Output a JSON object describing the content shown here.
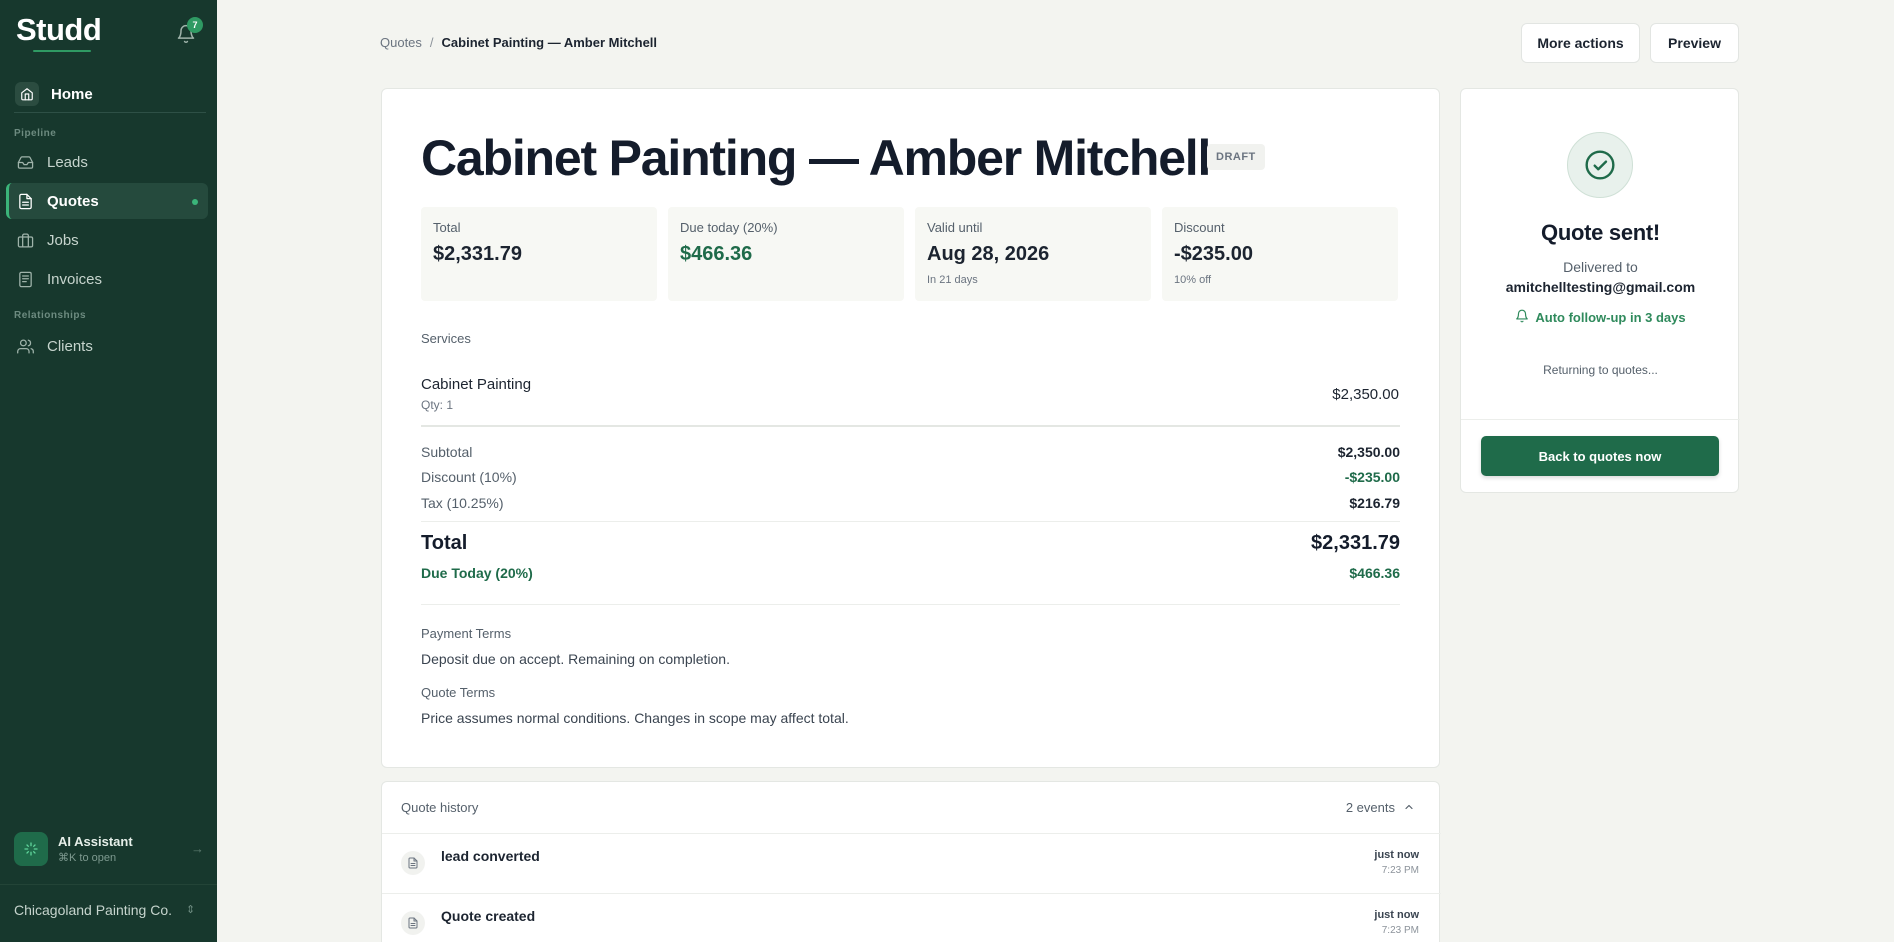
{
  "sidebar": {
    "logo": "Studd",
    "notifications_count": "7",
    "home_label": "Home",
    "sections": {
      "pipeline": "Pipeline",
      "relationships": "Relationships"
    },
    "items": [
      {
        "label": "Leads",
        "icon": "inbox-icon"
      },
      {
        "label": "Quotes",
        "icon": "document-icon"
      },
      {
        "label": "Jobs",
        "icon": "briefcase-icon"
      },
      {
        "label": "Invoices",
        "icon": "invoice-icon"
      },
      {
        "label": "Clients",
        "icon": "users-icon"
      }
    ],
    "ai_assistant": {
      "title": "AI Assistant",
      "shortcut": "⌘K to open"
    },
    "company": "Chicagoland Painting Co."
  },
  "breadcrumb": {
    "parent": "Quotes",
    "separator": "/",
    "current": "Cabinet Painting — Amber Mitchell"
  },
  "header_actions": {
    "more_actions": "More actions",
    "preview": "Preview"
  },
  "quote": {
    "title": "Cabinet Painting — Amber Mitchell",
    "status": "DRAFT",
    "stats": [
      {
        "label": "Total",
        "value": "$2,331.79",
        "sub": ""
      },
      {
        "label": "Due today (20%)",
        "value": "$466.36",
        "sub": ""
      },
      {
        "label": "Valid until",
        "value": "Aug 28, 2026",
        "sub": "In 21 days"
      },
      {
        "label": "Discount",
        "value": "-$235.00",
        "sub": "10% off"
      }
    ],
    "services_label": "Services",
    "services": [
      {
        "name": "Cabinet Painting",
        "qty": "Qty: 1",
        "amount": "$2,350.00"
      }
    ],
    "summary": {
      "subtotal_label": "Subtotal",
      "subtotal": "$2,350.00",
      "discount_label": "Discount (10%)",
      "discount": "-$235.00",
      "tax_label": "Tax (10.25%)",
      "tax": "$216.79",
      "total_label": "Total",
      "total": "$2,331.79",
      "due_label": "Due Today (20%)",
      "due": "$466.36"
    },
    "payment_terms_label": "Payment Terms",
    "payment_terms": "Deposit due on accept. Remaining on completion.",
    "quote_terms_label": "Quote Terms",
    "quote_terms": "Price assumes normal conditions. Changes in scope may affect total."
  },
  "history": {
    "title": "Quote history",
    "count": "2 events",
    "events": [
      {
        "name": "lead converted",
        "when": "just now",
        "time": "7:23 PM"
      },
      {
        "name": "Quote created",
        "when": "just now",
        "time": "7:23 PM"
      }
    ]
  },
  "sent_panel": {
    "title": "Quote sent!",
    "delivered_label": "Delivered to",
    "email": "amitchelltesting@gmail.com",
    "follow_up": "Auto follow-up in 3 days",
    "returning": "Returning to quotes...",
    "back_button": "Back to quotes now"
  },
  "colors": {
    "sidebar_bg": "#17382d",
    "accent": "#1f6b4a",
    "accent_light": "#2f9a63",
    "page_bg": "#f3f4f0"
  }
}
